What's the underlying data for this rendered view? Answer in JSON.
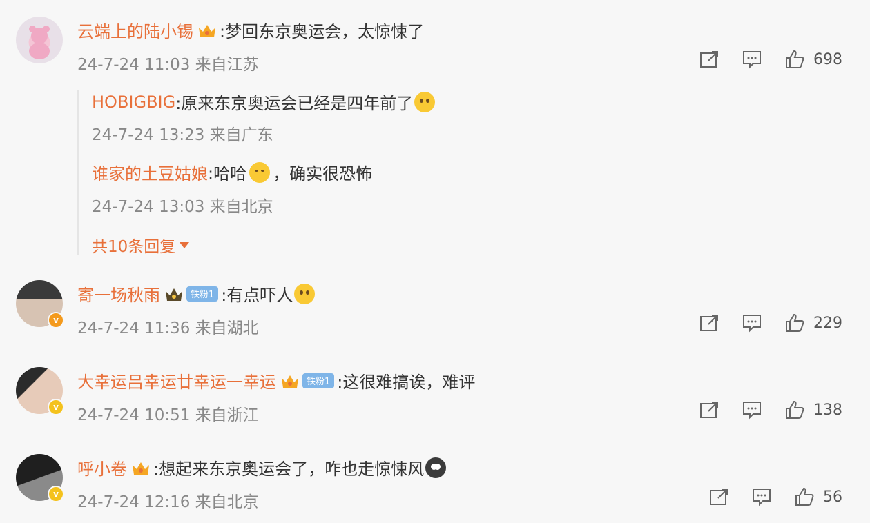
{
  "comments": [
    {
      "username": "云端上的陆小锡",
      "text": ":梦回东京奥运会，太惊悚了",
      "time": "24-7-24 11:03",
      "location": "来自江苏",
      "likes": "698",
      "replies": [
        {
          "username": "HOBIGBIG",
          "text": ":原来东京奥运会已经是四年前了",
          "time": "24-7-24 13:23",
          "location": "来自广东"
        },
        {
          "username": "谁家的土豆姑娘",
          "text": ":哈哈",
          "text2": "，确实很恐怖",
          "time": "24-7-24 13:03",
          "location": "来自北京"
        }
      ],
      "more_replies": "共10条回复"
    },
    {
      "username": "寄一场秋雨",
      "badge": "铁粉1",
      "text": ":有点吓人",
      "time": "24-7-24 11:36",
      "location": "来自湖北",
      "likes": "229"
    },
    {
      "username": "大幸运吕幸运廿幸运一幸运",
      "badge": "铁粉1",
      "text": ":这很难搞诶，难评",
      "time": "24-7-24 10:51",
      "location": "来自浙江",
      "likes": "138"
    },
    {
      "username": "呼小卷",
      "text": ":想起来东京奥运会了，咋也走惊悚风",
      "time": "24-7-24 12:16",
      "location": "来自北京",
      "likes": "56"
    }
  ],
  "colors": {
    "username": "#e8703a",
    "meta": "#888888",
    "background": "#f7f7f7"
  },
  "icons": [
    "share-icon",
    "comment-icon",
    "like-icon",
    "crown-icon",
    "verified-badge-icon"
  ]
}
